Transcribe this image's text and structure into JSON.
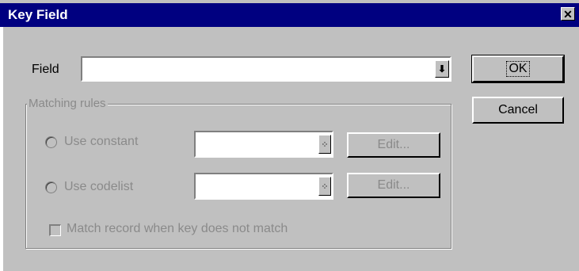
{
  "window": {
    "title": "Key Field",
    "close_glyph": "✕"
  },
  "field": {
    "label": "Field",
    "value": "",
    "dropdown_glyph": "⬇"
  },
  "buttons": {
    "ok": "OK",
    "cancel": "Cancel"
  },
  "matching_rules": {
    "legend": "Matching rules",
    "use_constant": {
      "label": "Use constant",
      "value": "",
      "picker_glyph": "⁘",
      "edit": "Edit..."
    },
    "use_codelist": {
      "label": "Use codelist",
      "value": "",
      "picker_glyph": "⁘",
      "edit": "Edit..."
    },
    "match_record_label": "Match record when key does not match"
  },
  "colors": {
    "titlebar": "#000080",
    "face": "#c0c0c0",
    "disabled_text": "#8a8a8a"
  }
}
